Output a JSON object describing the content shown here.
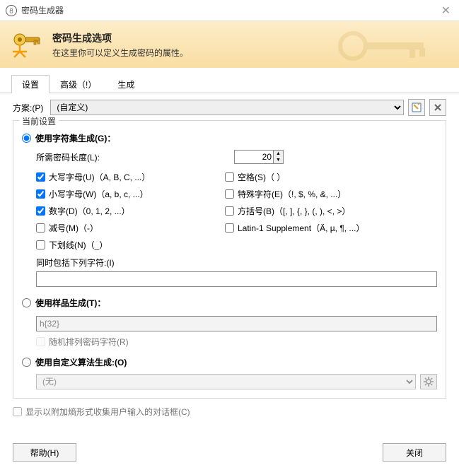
{
  "window": {
    "title": "密码生成器",
    "close": "✕"
  },
  "header": {
    "title": "密码生成选项",
    "subtitle": "在这里你可以定义生成密码的属性。"
  },
  "tabs": {
    "settings": "设置",
    "advanced": "高级（!）",
    "generate": "生成"
  },
  "profile": {
    "label": "方案:(P)",
    "value": "(自定义)"
  },
  "groupbox": {
    "legend": "当前设置"
  },
  "radios": {
    "charset": "使用字符集生成(G)：",
    "pattern": "使用样品生成(T)：",
    "algo": "使用自定义算法生成:(O)"
  },
  "length": {
    "label": "所需密码长度(L):",
    "value": "20"
  },
  "checks": {
    "upper": {
      "label": "大写字母(U)（A, B, C, ...）",
      "checked": true
    },
    "space": {
      "label": "空格(S)（ ）",
      "checked": false
    },
    "lower": {
      "label": "小写字母(W)（a, b, c, ...）",
      "checked": true
    },
    "special": {
      "label": "特殊字符(E)（!, $, %, &, ...）",
      "checked": false
    },
    "digit": {
      "label": "数字(D)（0, 1, 2, ...）",
      "checked": true
    },
    "bracket": {
      "label": "方括号(B)（[, ], {, }, (, ), <, >）",
      "checked": false
    },
    "minus": {
      "label": "减号(M)（-）",
      "checked": false
    },
    "latin1": {
      "label": "Latin-1 Supplement（Ä, µ, ¶, ...）",
      "checked": false
    },
    "under": {
      "label": "下划线(N)（_）",
      "checked": false
    }
  },
  "also": {
    "label": "同时包括下列字符:(I)",
    "value": ""
  },
  "pattern": {
    "value": "h{32}",
    "shuffle": "随机排列密码字符(R)"
  },
  "algo": {
    "value": "(无)"
  },
  "entropy": {
    "label": "显示以附加熵形式收集用户输入的对话框(C)"
  },
  "footer": {
    "help": "帮助(H)",
    "close": "关闭"
  }
}
